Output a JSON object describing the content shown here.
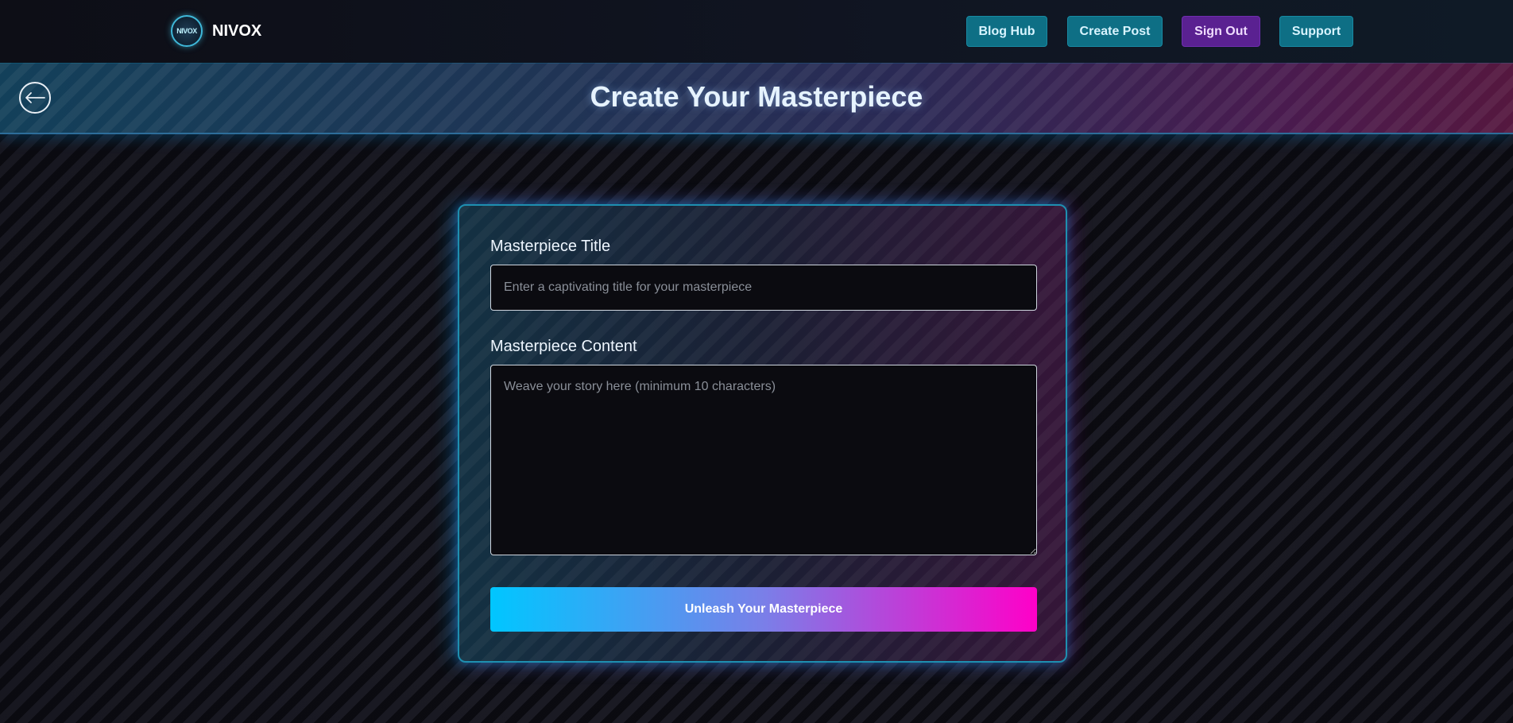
{
  "navbar": {
    "brand_name": "NIVOX",
    "logo_text": "NIVOX",
    "links": [
      {
        "label": "Blog Hub"
      },
      {
        "label": "Create Post"
      },
      {
        "label": "Sign Out"
      },
      {
        "label": "Support"
      }
    ]
  },
  "hero": {
    "title": "Create Your Masterpiece",
    "back_icon": "arrow-left-circle-icon"
  },
  "form": {
    "title_label": "Masterpiece Title",
    "title_value": "",
    "title_placeholder": "Enter a captivating title for your masterpiece",
    "content_label": "Masterpiece Content",
    "content_value": "",
    "content_placeholder": "Weave your story here (minimum 10 characters)",
    "submit_label": "Unleash Your Masterpiece"
  },
  "colors": {
    "accent_cyan": "#00c6ff",
    "accent_magenta": "#ff00c8",
    "nav_teal": "#0e6f85",
    "nav_purple": "#5a2191",
    "background": "#0b0b10"
  }
}
